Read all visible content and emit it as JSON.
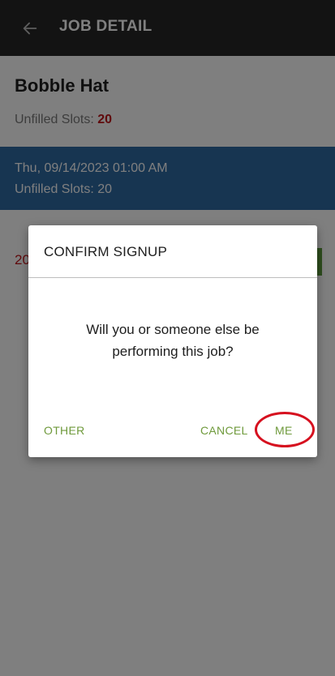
{
  "appbar": {
    "title": "JOB DETAIL",
    "back_icon": "arrow-left-icon"
  },
  "job": {
    "title": "Bobble Hat",
    "unfilled_label": "Unfilled Slots: ",
    "unfilled_count": "20"
  },
  "shift": {
    "date": "Thu, 09/14/2023 01:00 AM",
    "slots": "Unfilled Slots: 20"
  },
  "partial": {
    "text": "20"
  },
  "dialog": {
    "title": "CONFIRM SIGNUP",
    "message": "Will you or someone else be performing this job?",
    "buttons": {
      "other": "OTHER",
      "cancel": "CANCEL",
      "me": "ME"
    }
  },
  "colors": {
    "appbar": "#262626",
    "shift_row": "#2f6aa3",
    "accent_green": "#6f9a3c",
    "count_red": "#c0161a",
    "highlight_red": "#d6101f"
  }
}
